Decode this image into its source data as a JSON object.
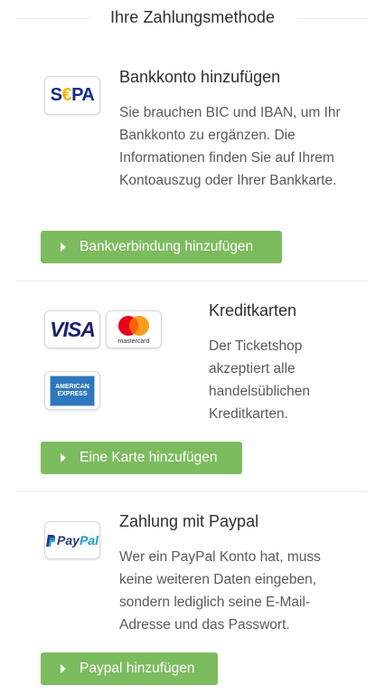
{
  "header": {
    "title": "Ihre Zahlungsmethode"
  },
  "sections": [
    {
      "heading": "Bankkonto hinzufügen",
      "description": "Sie brauchen BIC und IBAN, um Ihr Bankkonto zu ergänzen. Die Informationen finden Sie auf Ihrem Kontoauszug oder Ihrer Bankkarte.",
      "button_label": "Bankverbindung hinzufügen",
      "logos": [
        {
          "name": "sepa-logo",
          "text_main": "S",
          "text_euro": "€",
          "text_rest": "PA"
        }
      ]
    },
    {
      "heading": "Kreditkarten",
      "description": "Der Ticketshop akzeptiert alle handelsüblichen Kreditkarten.",
      "button_label": "Eine Karte hinzufügen",
      "logos": [
        {
          "name": "visa-logo",
          "text": "VISA"
        },
        {
          "name": "mastercard-logo",
          "text": "mastercard"
        },
        {
          "name": "american-express-logo",
          "text_line1": "AMERICAN",
          "text_line2": "EXPRESS"
        }
      ]
    },
    {
      "heading": "Zahlung mit Paypal",
      "description": "Wer ein PayPal Konto hat, muss keine weiteren Daten eingeben, sondern lediglich seine E-Mail-Adresse und das Passwort.",
      "button_label": "Paypal hinzufügen",
      "logos": [
        {
          "name": "paypal-logo",
          "text_a": "Pay",
          "text_b": "Pal"
        }
      ]
    }
  ],
  "colors": {
    "button_green": "#7cbb5e",
    "sepa_blue": "#10298e",
    "sepa_yellow": "#f7b500",
    "visa_blue": "#1a1f71",
    "mastercard_red": "#eb001b",
    "mastercard_orange": "#f79e1b",
    "amex_blue": "#2e77bc",
    "paypal_dark": "#253b80",
    "paypal_light": "#179bd7"
  }
}
